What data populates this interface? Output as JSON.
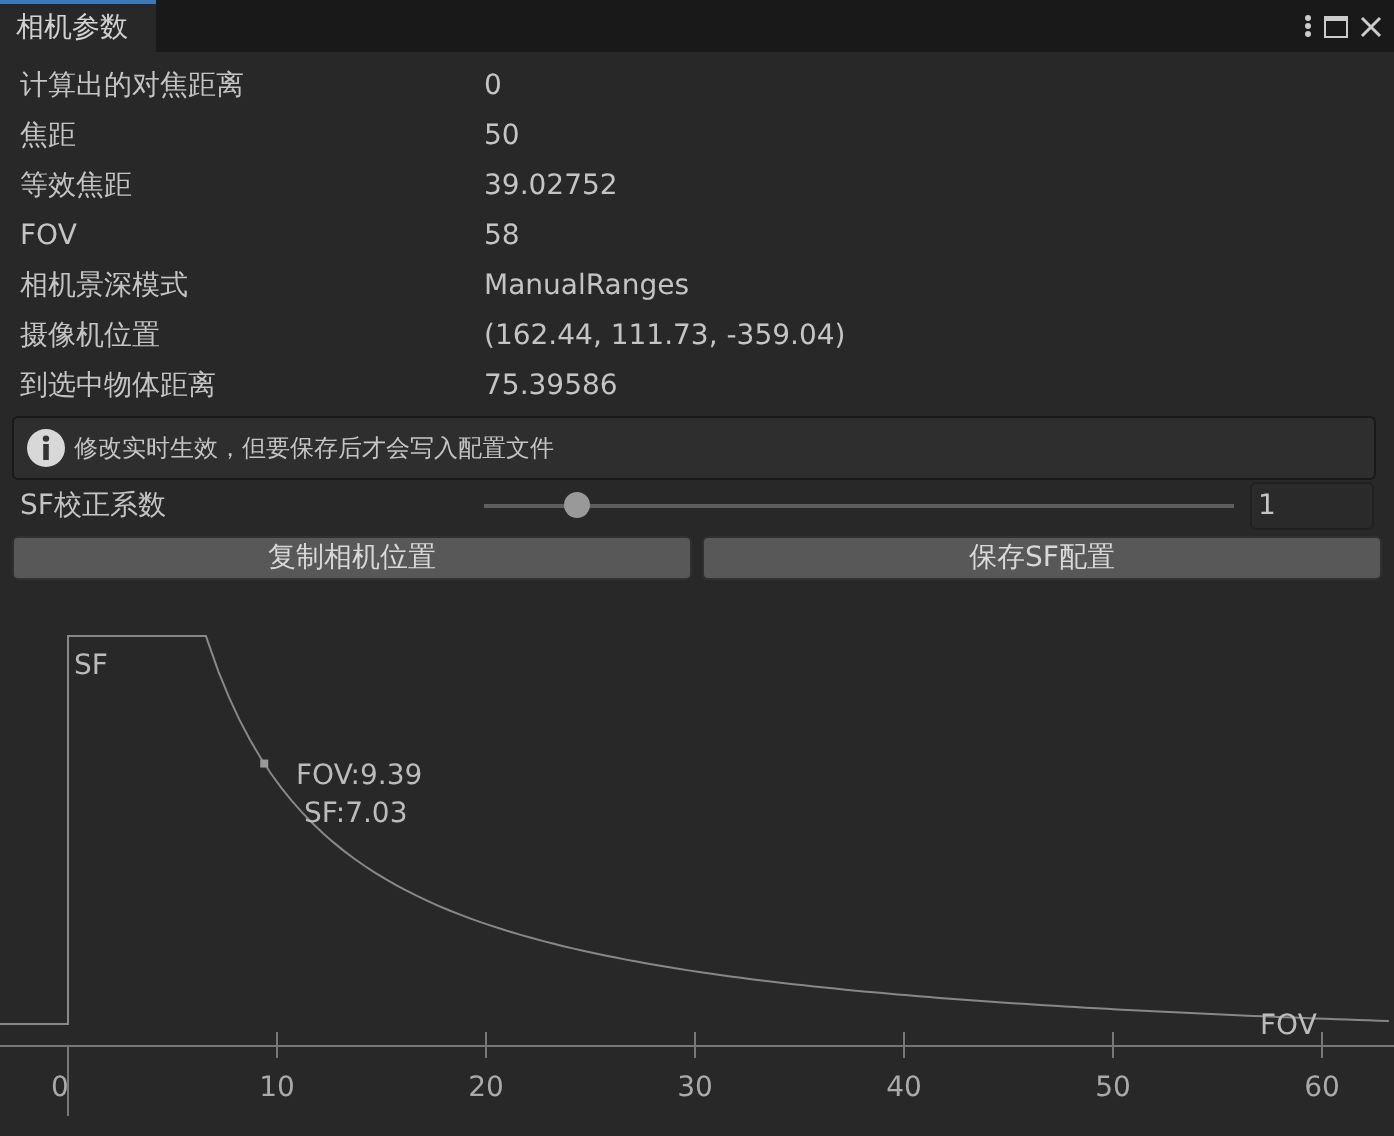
{
  "window": {
    "tab": "相机参数"
  },
  "fields": [
    {
      "label": "计算出的对焦距离",
      "value": "0"
    },
    {
      "label": "焦距",
      "value": "50"
    },
    {
      "label": "等效焦距",
      "value": "39.02752"
    },
    {
      "label": "FOV",
      "value": "58"
    },
    {
      "label": "相机景深模式",
      "value": "ManualRanges"
    },
    {
      "label": "摄像机位置",
      "value": "(162.44, 111.73, -359.04)"
    },
    {
      "label": "到选中物体距离",
      "value": "75.39586"
    }
  ],
  "info": "修改实时生效，但要保存后才会写入配置文件",
  "slider": {
    "label": "SF校正系数",
    "level": 0.11,
    "value": "1"
  },
  "buttons": [
    "复制相机位置",
    "保存SF配置"
  ],
  "curve": {
    "y_name": "SF",
    "x_name": "FOV",
    "point": [
      "FOV:9.39",
      "SF:7.03"
    ],
    "xticks": [
      "0",
      "10",
      "20",
      "30",
      "40",
      "50",
      "60"
    ]
  }
}
